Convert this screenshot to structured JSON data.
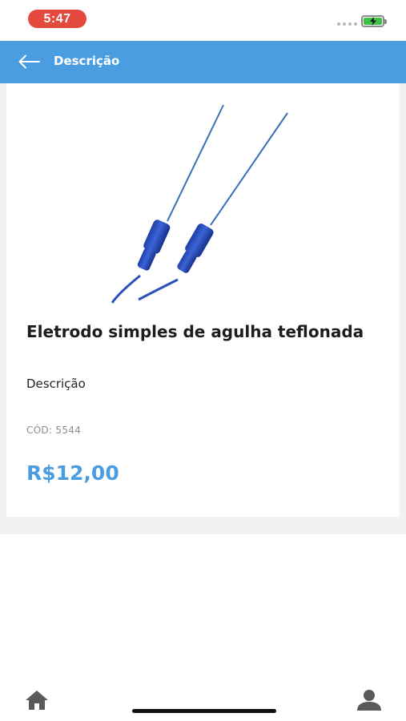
{
  "status_bar": {
    "time": "5:47",
    "battery_icon": "battery-charging-icon",
    "colors": {
      "time_pill": "#e5483d",
      "battery_fill": "#3fc14a"
    }
  },
  "app_bar": {
    "title": "Descrição",
    "back_icon": "arrow-left-icon",
    "color": "#4b9de2"
  },
  "product": {
    "image": "needle-electrode-image",
    "title": "Eletrodo simples de agulha teflonada",
    "description_label": "Descrição",
    "code": "CÓD: 5544",
    "price": "R$12,00",
    "price_color": "#4b9de2"
  },
  "tab_bar": {
    "home_icon": "home-icon",
    "profile_icon": "user-icon"
  }
}
